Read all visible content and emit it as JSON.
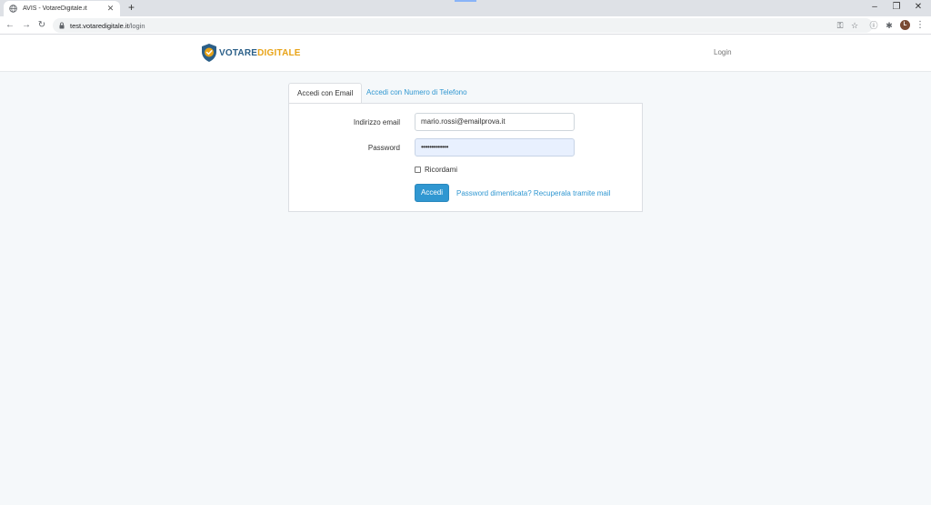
{
  "browser": {
    "tab_title": "AVIS - VotareDigitale.it",
    "url_host": "test.votaredigitale.it",
    "url_path": "/login",
    "avatar_letter": "L"
  },
  "navbar": {
    "brand_part1": "VOTARE",
    "brand_part2": "DIGITALE",
    "login_link": "Login"
  },
  "login": {
    "tabs": [
      {
        "label": "Accedi con Email",
        "active": true
      },
      {
        "label": "Accedi con Numero di Telefono",
        "active": false
      }
    ],
    "email_label": "Indirizzo email",
    "email_value": "mario.rossi@emailprova.it",
    "password_label": "Password",
    "password_value": "•••••••••••••",
    "remember_label": "Ricordami",
    "submit_label": "Accedi",
    "forgot_link": "Password dimenticata? Recuperala tramite mail"
  },
  "colors": {
    "accent": "#3097d1",
    "brand_blue": "#2b5f88",
    "brand_gold": "#e8a317",
    "page_bg": "#f5f8fa"
  },
  "icons": {
    "tab": "globe-icon",
    "brand": "shield-check-icon",
    "back": "back-arrow-icon",
    "forward": "forward-arrow-icon",
    "reload": "reload-icon"
  }
}
